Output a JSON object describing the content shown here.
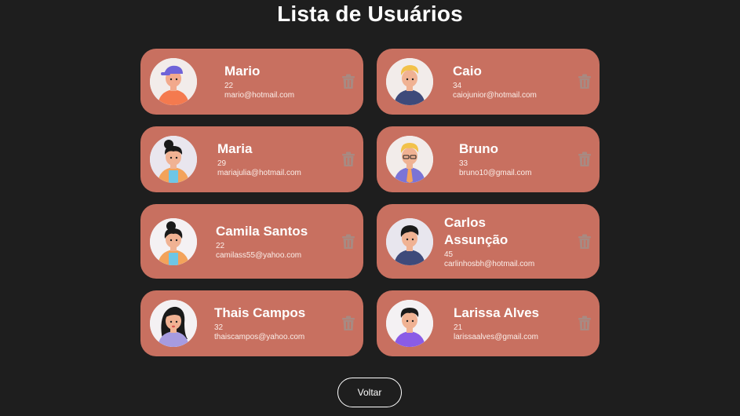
{
  "page": {
    "title": "Lista de Usuários"
  },
  "users": [
    {
      "name": "Mario",
      "age": "22",
      "email": "mario@hotmail.com",
      "avatar": "cap-boy-avatar",
      "shirt": "#f47a4f",
      "hair": "#222222",
      "skin": "#f2a98c",
      "hat": "#6f63d8"
    },
    {
      "name": "Caio",
      "age": "34",
      "email": "caiojunior@hotmail.com",
      "avatar": "blonde-boy-avatar",
      "shirt": "#3e4a7a",
      "hair": "#f2c24a",
      "skin": "#f0b293"
    },
    {
      "name": "Maria",
      "age": "29",
      "email": "mariajulia@hotmail.com",
      "avatar": "bun-girl-avatar",
      "shirt": "#f3a35b",
      "hair": "#1a1a1a",
      "skin": "#f0b293"
    },
    {
      "name": "Bruno",
      "age": "33",
      "email": "bruno10@gmail.com",
      "avatar": "tie-man-avatar",
      "shirt": "#7b74d6",
      "hair": "#f2c24a",
      "skin": "#f0b293"
    },
    {
      "name": "Camila Santos",
      "age": "22",
      "email": "camilass55@yahoo.com",
      "avatar": "bun-girl-blue-avatar",
      "shirt": "#f3a35b",
      "hair": "#1a1a1a",
      "skin": "#f0b293"
    },
    {
      "name": "Carlos Assunção",
      "age": "45",
      "email": "carlinhosbh@hotmail.com",
      "avatar": "dark-hair-man-avatar",
      "shirt": "#3e4a7a",
      "hair": "#1a1a1a",
      "skin": "#f0b293"
    },
    {
      "name": "Thais Campos",
      "age": "32",
      "email": "thaiscampos@yahoo.com",
      "avatar": "long-hair-girl-avatar",
      "shirt": "#a69be0",
      "hair": "#1a1a1a",
      "skin": "#f0b293"
    },
    {
      "name": "Larissa Alves",
      "age": "21",
      "email": "larissaalves@gmail.com",
      "avatar": "purple-shirt-avatar",
      "shirt": "#8a5ce6",
      "hair": "#1a1a1a",
      "skin": "#f0b293"
    }
  ],
  "actions": {
    "back_label": "Voltar"
  },
  "colors": {
    "background": "#1e1e1e",
    "card": "#c87060",
    "trash_icon": "#a88a82"
  }
}
